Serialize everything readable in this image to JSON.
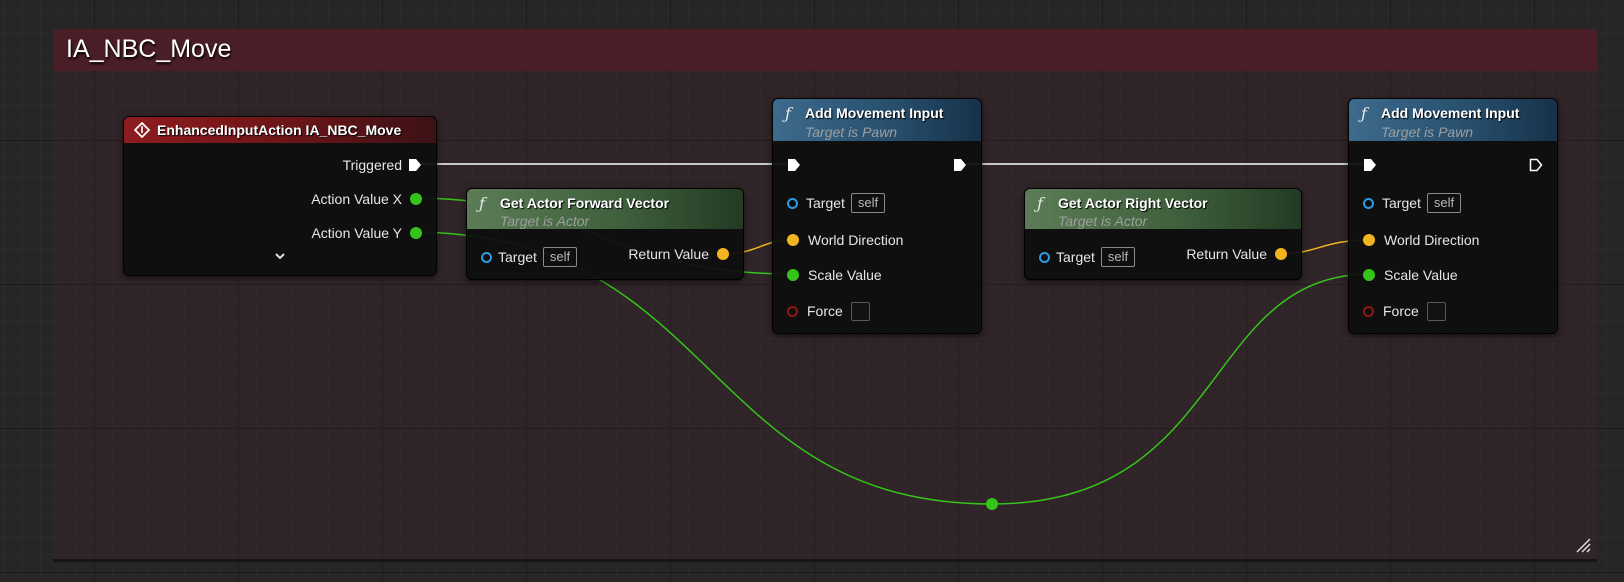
{
  "comment": {
    "title": "IA_NBC_Move",
    "color": "#4a1e27"
  },
  "colors": {
    "exec_wire": "#c8c8c8",
    "float_wire": "#35c41a",
    "vector_wire": "#f2b51f",
    "object_pin": "#2f9be0",
    "bool_pin": "#8e1a12"
  },
  "event_node": {
    "icon": "event-diamond-icon",
    "title": "EnhancedInputAction IA_NBC_Move",
    "outputs": [
      "Triggered",
      "Action Value X",
      "Action Value Y"
    ],
    "expand_icon": "chevron-down-icon"
  },
  "forward_node": {
    "icon": "function-icon",
    "title": "Get Actor Forward Vector",
    "subtitle": "Target is Actor",
    "target_label": "Target",
    "target_value": "self",
    "return_label": "Return Value"
  },
  "right_node": {
    "icon": "function-icon",
    "title": "Get Actor Right Vector",
    "subtitle": "Target is Actor",
    "target_label": "Target",
    "target_value": "self",
    "return_label": "Return Value"
  },
  "move_node_1": {
    "icon": "function-icon",
    "title": "Add Movement Input",
    "subtitle": "Target is Pawn",
    "target_label": "Target",
    "target_value": "self",
    "world_direction_label": "World Direction",
    "scale_value_label": "Scale Value",
    "force_label": "Force"
  },
  "move_node_2": {
    "icon": "function-icon",
    "title": "Add Movement Input",
    "subtitle": "Target is Pawn",
    "target_label": "Target",
    "target_value": "self",
    "world_direction_label": "World Direction",
    "scale_value_label": "Scale Value",
    "force_label": "Force"
  },
  "reroute": {
    "icon": "reroute-knot-icon"
  }
}
